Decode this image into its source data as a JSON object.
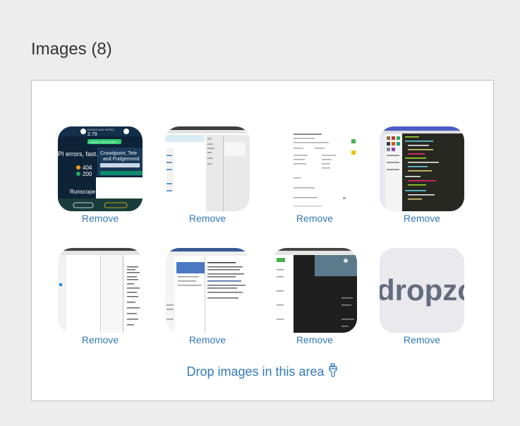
{
  "header": {
    "title": "Images (8)"
  },
  "dropzone": {
    "message": "Drop images in this area",
    "icon": "hand-pointer-icon",
    "accent_color": "#337ab7"
  },
  "previews": [
    {
      "kind": "speedtest-screenshot",
      "remove_label": "Remove",
      "text": {
        "speed": "2.79",
        "button": "SHARE THIS RESULT",
        "errors": "PI errors, fast.",
        "code404": "404",
        "code200": "200",
        "brand": "Runscope",
        "host1": "Crowdpoint, Tele",
        "host2": "and Pudgemond"
      }
    },
    {
      "kind": "browser-screenshot",
      "remove_label": "Remove"
    },
    {
      "kind": "document-screenshot",
      "remove_label": "Remove"
    },
    {
      "kind": "code-editor-screenshot",
      "remove_label": "Remove"
    },
    {
      "kind": "webpage-screenshot",
      "remove_label": "Remove"
    },
    {
      "kind": "forum-screenshot",
      "remove_label": "Remove"
    },
    {
      "kind": "dark-site-screenshot",
      "remove_label": "Remove"
    },
    {
      "kind": "dropzone-logo",
      "remove_label": "Remove",
      "text": {
        "logo": "dropzone"
      }
    }
  ]
}
